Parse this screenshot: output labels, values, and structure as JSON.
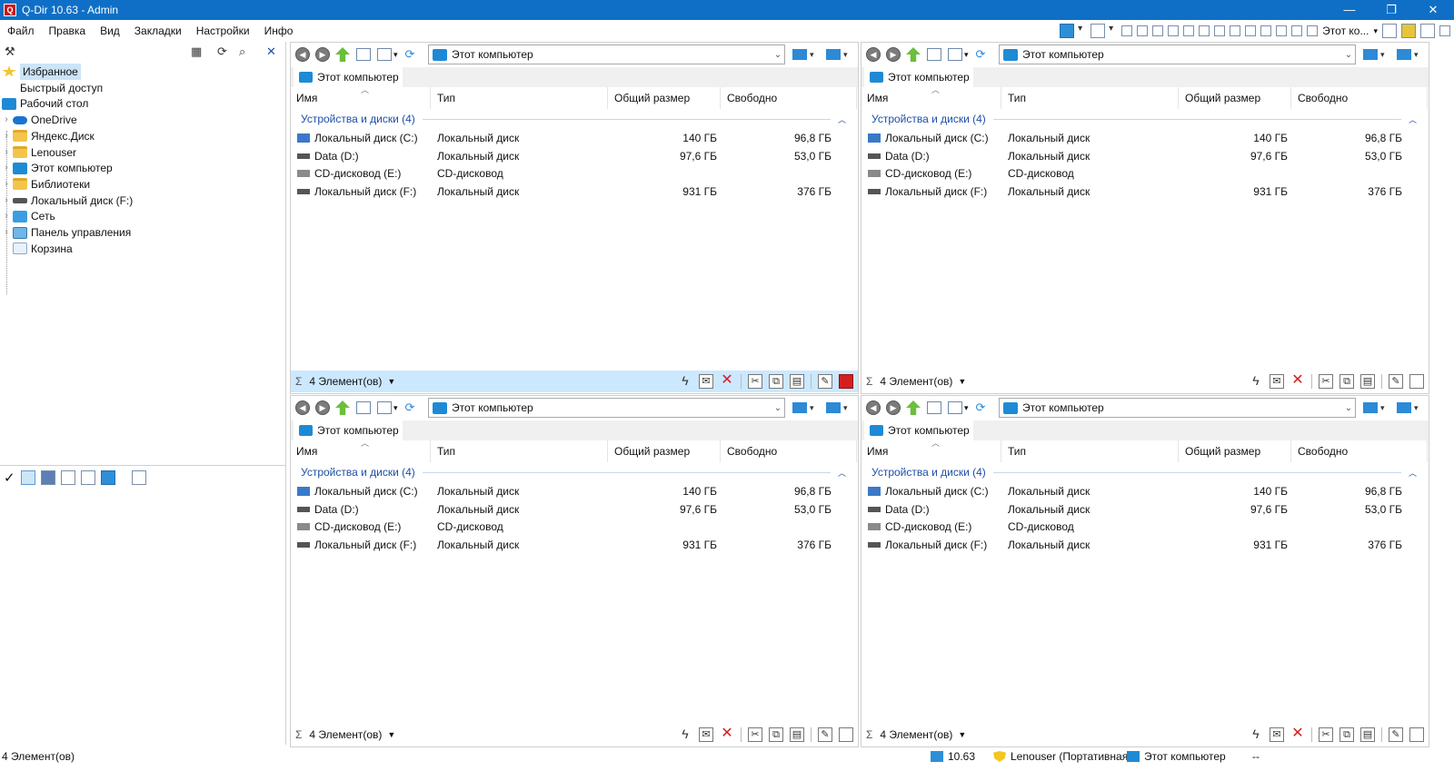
{
  "window": {
    "title": "Q-Dir 10.63 - Admin"
  },
  "menu": [
    "Файл",
    "Правка",
    "Вид",
    "Закладки",
    "Настройки",
    "Инфо"
  ],
  "top_toolbar": {
    "location_label": "Этот ко..."
  },
  "tree": {
    "items": [
      {
        "label": "Избранное",
        "icon": "star-icon",
        "expandable": false,
        "selected": true
      },
      {
        "label": "Быстрый доступ",
        "icon": "",
        "expandable": false,
        "selected": false
      },
      {
        "label": "Рабочий стол",
        "icon": "desktop-icon",
        "expandable": false,
        "selected": false
      },
      {
        "label": "OneDrive",
        "icon": "onedrive-icon",
        "expandable": true,
        "selected": false
      },
      {
        "label": "Яндекс.Диск",
        "icon": "folder-icon",
        "expandable": true,
        "selected": false
      },
      {
        "label": "Lenouser",
        "icon": "folder-icon",
        "expandable": true,
        "selected": false
      },
      {
        "label": "Этот компьютер",
        "icon": "computer-icon",
        "expandable": true,
        "selected": false
      },
      {
        "label": "Библиотеки",
        "icon": "folder-icon",
        "expandable": true,
        "selected": false
      },
      {
        "label": "Локальный диск (F:)",
        "icon": "drive-icon",
        "expandable": true,
        "selected": false
      },
      {
        "label": "Сеть",
        "icon": "network-icon",
        "expandable": true,
        "selected": false
      },
      {
        "label": "Панель управления",
        "icon": "control-panel-icon",
        "expandable": true,
        "selected": false
      },
      {
        "label": "Корзина",
        "icon": "recycle-bin-icon",
        "expandable": false,
        "selected": false
      }
    ]
  },
  "pane_common": {
    "address": "Этот компьютер",
    "tab": "Этот компьютер",
    "columns": [
      "Имя",
      "Тип",
      "Общий размер",
      "Свободно"
    ],
    "group": "Устройства и диски (4)",
    "rows": [
      {
        "name": "Локальный диск (C:)",
        "type": "Локальный диск",
        "size": "140 ГБ",
        "free": "96,8 ГБ",
        "icon": "win"
      },
      {
        "name": "Data (D:)",
        "type": "Локальный диск",
        "size": "97,6 ГБ",
        "free": "53,0 ГБ",
        "icon": ""
      },
      {
        "name": "CD-дисковод (E:)",
        "type": "CD-дисковод",
        "size": "",
        "free": "",
        "icon": "cd"
      },
      {
        "name": "Локальный диск (F:)",
        "type": "Локальный диск",
        "size": "931 ГБ",
        "free": "376 ГБ",
        "icon": ""
      }
    ],
    "status": "4 Элемент(ов)"
  },
  "panes": [
    {
      "id": "top-left",
      "active": true
    },
    {
      "id": "top-right",
      "active": false
    },
    {
      "id": "bottom-left",
      "active": false
    },
    {
      "id": "bottom-right",
      "active": false
    }
  ],
  "app_status": {
    "items": "4 Элемент(ов)",
    "version": "10.63",
    "user": "Lenouser (Портативная",
    "location": "Этот компьютер",
    "extra": "--"
  },
  "colors": {
    "titlebar": "#0f6fc6",
    "active_status": "#cce8ff",
    "selection": "#cce4f7",
    "group_text": "#1e4fa8"
  }
}
